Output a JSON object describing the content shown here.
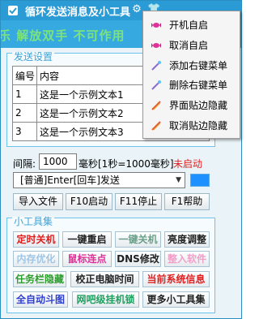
{
  "window": {
    "title": "循环发送消息及小工具"
  },
  "banner": {
    "text": "乐  解放双手  不可作用"
  },
  "send_group": {
    "title": "发送设置",
    "columns": [
      "编号",
      "内容"
    ],
    "rows": [
      {
        "no": "1",
        "text": "这是一个示例文本1"
      },
      {
        "no": "2",
        "text": "这是一个示例文本2"
      },
      {
        "no": "3",
        "text": "这是一个示例文本3"
      }
    ]
  },
  "interval": {
    "label": "间隔:",
    "value": "1000",
    "unit": "毫秒[1秒=1000毫秒]"
  },
  "status": {
    "text": "未启动",
    "color": "#e02020"
  },
  "mode": {
    "selected": "[普通]Enter[回车]发送"
  },
  "swatch_color": "#1e90ff",
  "actions": {
    "import": "导入文件",
    "start": "F10启动",
    "stop": "F11停止",
    "help": "F1帮助"
  },
  "tools_group": {
    "title": "小工具集",
    "buttons": [
      {
        "label": "定时关机",
        "color": "#e02020"
      },
      {
        "label": "一键重启",
        "color": "#222222"
      },
      {
        "label": "一键关机",
        "color": "#6aa08a"
      },
      {
        "label": "亮度调整",
        "color": "#222222"
      },
      {
        "label": "内存优化",
        "color": "#9ec6e6"
      },
      {
        "label": "鼠标连点",
        "color": "#e0309a"
      },
      {
        "label": "DNS修改",
        "color": "#222222"
      },
      {
        "label": "整入软件",
        "color": "#f0a0c8"
      },
      {
        "label": "任务栏隐藏",
        "color": "#2e9e2e"
      },
      {
        "label": "校正电脑时间",
        "color": "#222222"
      },
      {
        "label": "当前系统信息",
        "color": "#e02020"
      },
      {
        "label": "全自动斗图",
        "color": "#3040d0"
      },
      {
        "label": "网吧级挂机锁",
        "color": "#20a060"
      },
      {
        "label": "更多小工具集",
        "color": "#222222"
      }
    ]
  },
  "context_menu": {
    "items": [
      "开机自启",
      "取消自启",
      "添加右键菜单",
      "删除右键菜单",
      "界面贴边隐藏",
      "取消贴边隐藏"
    ]
  }
}
